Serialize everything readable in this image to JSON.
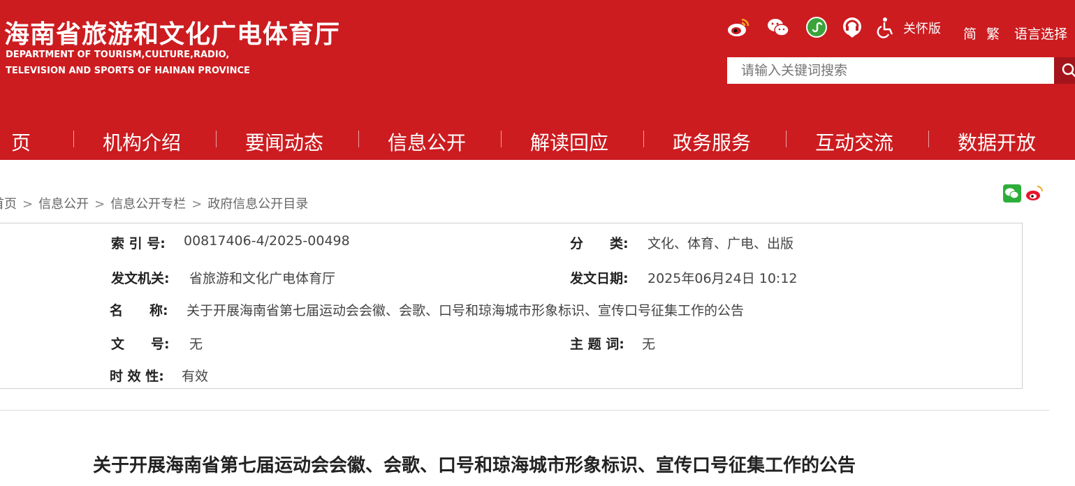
{
  "header": {
    "title": "海南省旅游和文化广电体育厅",
    "subtitle_line1": "DEPARTMENT OF TOURISM,CULTURE,RADIO,",
    "subtitle_line2": "TELEVISION AND SPORTS OF HAINAN PROVINCE",
    "care_version": "关怀版",
    "lang_simplified": "简",
    "lang_traditional": "繁",
    "lang_select": "语言选择",
    "icons": [
      "weibo-icon",
      "wechat-icon",
      "mini-program-icon",
      "app-icon",
      "accessibility-icon"
    ]
  },
  "search": {
    "placeholder": "请输入关键词搜索"
  },
  "nav": {
    "items": [
      "页",
      "机构介绍",
      "要闻动态",
      "信息公开",
      "解读回应",
      "政务服务",
      "互动交流",
      "数据开放"
    ]
  },
  "breadcrumb": [
    "首页",
    "信息公开",
    "信息公开专栏",
    "政府信息公开目录"
  ],
  "breadcrumb_sep": ">",
  "meta": {
    "index_label": "索 引 号:",
    "index_value": "00817406-4/2025-00498",
    "category_label": "分　　类:",
    "category_value": "文化、体育、广电、出版",
    "issuer_label": "发文机关:",
    "issuer_value": "省旅游和文化广电体育厅",
    "date_label": "发文日期:",
    "date_value": "2025年06月24日 10:12",
    "name_label": "名　　称:",
    "name_value": "关于开展海南省第七届运动会会徽、会歌、口号和琼海城市形象标识、宣传口号征集工作的公告",
    "docno_label": "文　　号:",
    "docno_value": "无",
    "subject_label": "主 题 词:",
    "subject_value": "无",
    "validity_label": "时 效 性:",
    "validity_value": "有效"
  },
  "document": {
    "title": "关于开展海南省第七届运动会会徽、会歌、口号和琼海城市形象标识、宣传口号征集工作的公告"
  },
  "colors": {
    "brand_red": "#cc1c20",
    "search_button": "#a3151a"
  }
}
